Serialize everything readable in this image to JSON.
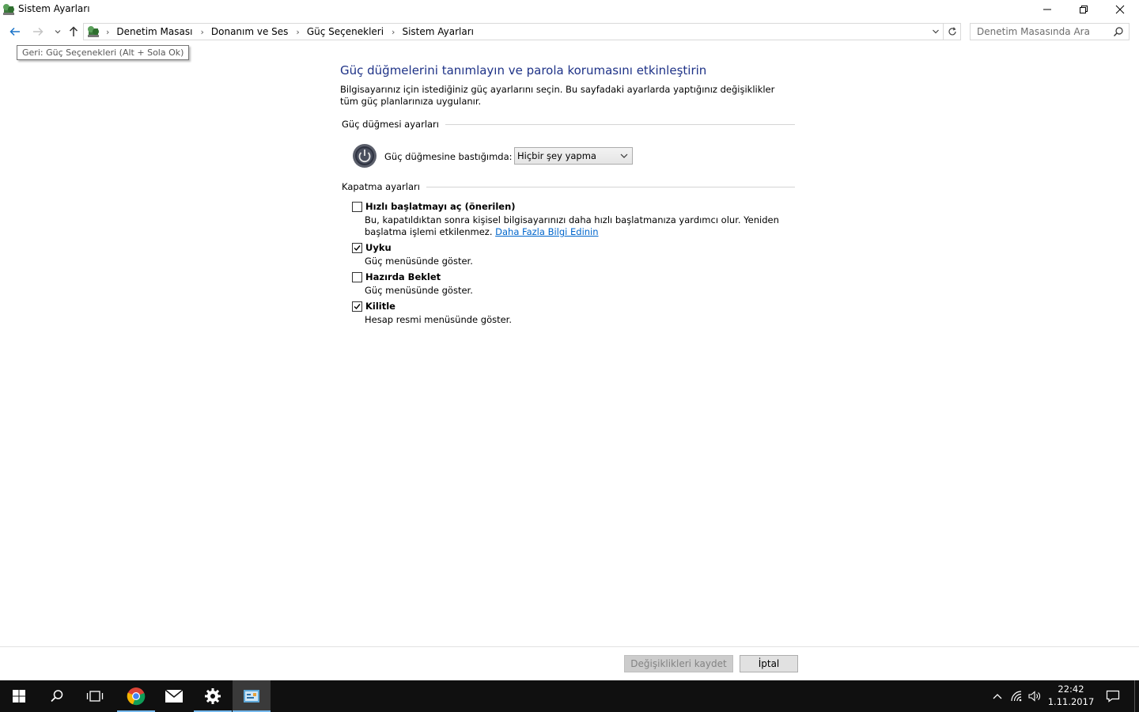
{
  "window": {
    "title": "Sistem Ayarları"
  },
  "nav": {
    "breadcrumbs": [
      "Denetim Masası",
      "Donanım ve Ses",
      "Güç Seçenekleri",
      "Sistem Ayarları"
    ],
    "search_placeholder": "Denetim Masasında Ara"
  },
  "tooltip": {
    "text": "Geri:  Güç Seçenekleri (Alt + Sola Ok)"
  },
  "main": {
    "title": "Güç düğmelerini tanımlayın ve parola korumasını etkinleştirin",
    "description": "Bilgisayarınız için istediğiniz güç ayarlarını seçin. Bu sayfadaki ayarlarda yaptığınız değişiklikler tüm güç planlarınıza uygulanır.",
    "power_section": {
      "heading": "Güç düğmesi ayarları",
      "label": "Güç düğmesine bastığımda:",
      "selected": "Hiçbir şey yapma"
    },
    "shutdown_section": {
      "heading": "Kapatma ayarları",
      "options": [
        {
          "title": "Hızlı başlatmayı aç (önerilen)",
          "desc": "Bu, kapatıldıktan sonra kişisel bilgisayarınızı daha hızlı başlatmanıza yardımcı olur. Yeniden başlatma işlemi etkilenmez. ",
          "link": "Daha Fazla Bilgi Edinin",
          "checked": false
        },
        {
          "title": "Uyku",
          "desc": "Güç menüsünde göster.",
          "checked": true
        },
        {
          "title": "Hazırda Beklet",
          "desc": "Güç menüsünde göster.",
          "checked": false
        },
        {
          "title": "Kilitle",
          "desc": "Hesap resmi menüsünde göster.",
          "checked": true
        }
      ]
    }
  },
  "buttons": {
    "save": "Değişiklikleri kaydet",
    "cancel": "İptal"
  },
  "taskbar": {
    "time": "22:42",
    "date": "1.11.2017",
    "accent": "#76b9ed"
  }
}
